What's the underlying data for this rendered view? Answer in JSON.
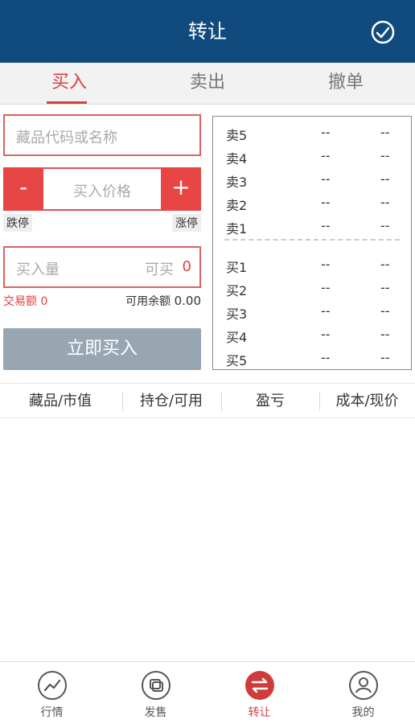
{
  "header": {
    "title": "转让"
  },
  "tabs": [
    {
      "label": "买入",
      "active": true
    },
    {
      "label": "卖出",
      "active": false
    },
    {
      "label": "撤单",
      "active": false
    }
  ],
  "form": {
    "code_placeholder": "藏品代码或名称",
    "minus_label": "-",
    "price_placeholder": "买入价格",
    "plus_label": "+",
    "limit_down": "跌停",
    "limit_up": "涨停",
    "qty_placeholder": "买入量",
    "available_label": "可买",
    "available_value": "0",
    "turnover_label": "交易额",
    "turnover_value": "0",
    "balance_label": "可用余额",
    "balance_value": "0.00",
    "buy_button": "立即买入"
  },
  "orderbook": {
    "sells": [
      {
        "label": "卖5",
        "price": "--",
        "volume": "--"
      },
      {
        "label": "卖4",
        "price": "--",
        "volume": "--"
      },
      {
        "label": "卖3",
        "price": "--",
        "volume": "--"
      },
      {
        "label": "卖2",
        "price": "--",
        "volume": "--"
      },
      {
        "label": "卖1",
        "price": "--",
        "volume": "--"
      }
    ],
    "buys": [
      {
        "label": "买1",
        "price": "--",
        "volume": "--"
      },
      {
        "label": "买2",
        "price": "--",
        "volume": "--"
      },
      {
        "label": "买3",
        "price": "--",
        "volume": "--"
      },
      {
        "label": "买4",
        "price": "--",
        "volume": "--"
      },
      {
        "label": "买5",
        "price": "--",
        "volume": "--"
      }
    ]
  },
  "holdings": {
    "columns": [
      "藏品/市值",
      "持仓/可用",
      "盈亏",
      "成本/现价"
    ]
  },
  "nav": [
    {
      "label": "行情",
      "icon": "market-chart-icon",
      "active": false
    },
    {
      "label": "发售",
      "icon": "issue-icon",
      "active": false
    },
    {
      "label": "转让",
      "icon": "transfer-icon",
      "active": true
    },
    {
      "label": "我的",
      "icon": "profile-icon",
      "active": false
    }
  ],
  "colors": {
    "header_bg": "#114a7c",
    "accent_red": "#d94040",
    "buy_button_bg": "#98a6b2"
  }
}
